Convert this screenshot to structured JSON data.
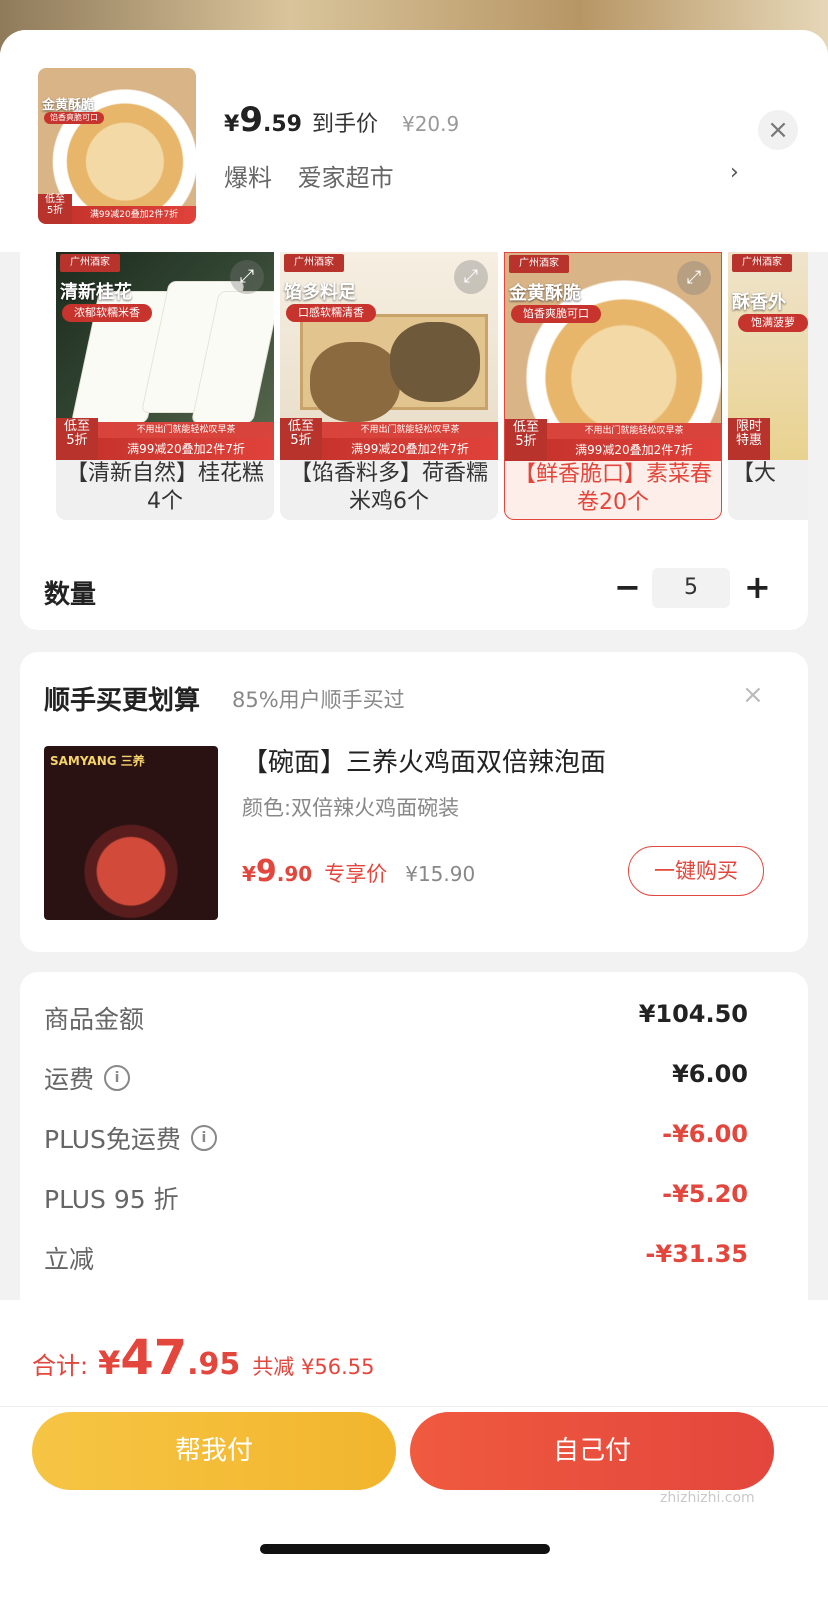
{
  "header": {
    "price_symbol": "¥",
    "price_int": "9",
    "price_dec": ".59",
    "price_label": "到手价",
    "original_price": "¥20.9",
    "tags": [
      "爆料",
      "爱家超市"
    ],
    "chevron": "›",
    "close": "×"
  },
  "promo": {
    "brand": "广州酒家",
    "low": "低至",
    "five_zhe": "5折",
    "tagline": "不用出门就能轻松叹早茶",
    "deal": "满99减20叠加2件7折",
    "deal_short": "满99减20叠加2件7折",
    "limited": "限时",
    "special": "特惠"
  },
  "skus": [
    {
      "img_title": "清新桂花",
      "img_sub": "浓郁软糯米香",
      "name": "【清新自然】桂花糕4个",
      "selected": false
    },
    {
      "img_title": "馅多料足",
      "img_sub": "口感软糯清香",
      "name": "【馅香料多】荷香糯米鸡6个",
      "selected": false
    },
    {
      "img_title": "金黄酥脆",
      "img_sub": "馅香爽脆可口",
      "name": "【鲜香脆口】素菜春卷20个",
      "selected": true
    },
    {
      "img_title": "酥香外",
      "img_sub": "饱满菠萝",
      "name": "【大",
      "selected": false
    }
  ],
  "header_img": {
    "title": "金黄酥脆",
    "sub": "馅香爽脆可口"
  },
  "quantity": {
    "label": "数量",
    "minus": "−",
    "value": "5",
    "plus": "+"
  },
  "addon": {
    "title": "顺手买更划算",
    "subtitle": "85%用户顺手买过",
    "close": "×",
    "product_name": "【碗面】三养火鸡面双倍辣泡面",
    "spec": "颜色:双倍辣火鸡面碗装",
    "price_symbol": "¥",
    "price_int": "9",
    "price_dec": ".90",
    "price_tag": "专享价",
    "original_price": "¥15.90",
    "buy_button": "一键购买",
    "img_brand": "SAMYANG 三养"
  },
  "summary": [
    {
      "label": "商品金额",
      "value": "¥104.50",
      "info": false,
      "red": false
    },
    {
      "label": "运费",
      "value": "¥6.00",
      "info": true,
      "red": false
    },
    {
      "label": "PLUS免运费",
      "value": "-¥6.00",
      "info": true,
      "red": true
    },
    {
      "label": "PLUS 95 折",
      "value": "-¥5.20",
      "info": false,
      "red": true
    },
    {
      "label": "立减",
      "value": "-¥31.35",
      "info": false,
      "red": true
    }
  ],
  "info_icon": "i",
  "total": {
    "label": "合计:",
    "symbol": "¥",
    "int": "47",
    "dec": ".95",
    "saved": "共减 ¥56.55"
  },
  "buttons": {
    "help_pay": "帮我付",
    "self_pay": "自己付"
  },
  "watermark": "zhizhizhi.com",
  "colors": {
    "accent": "#e3463c",
    "yellow": "#f2b52d"
  }
}
